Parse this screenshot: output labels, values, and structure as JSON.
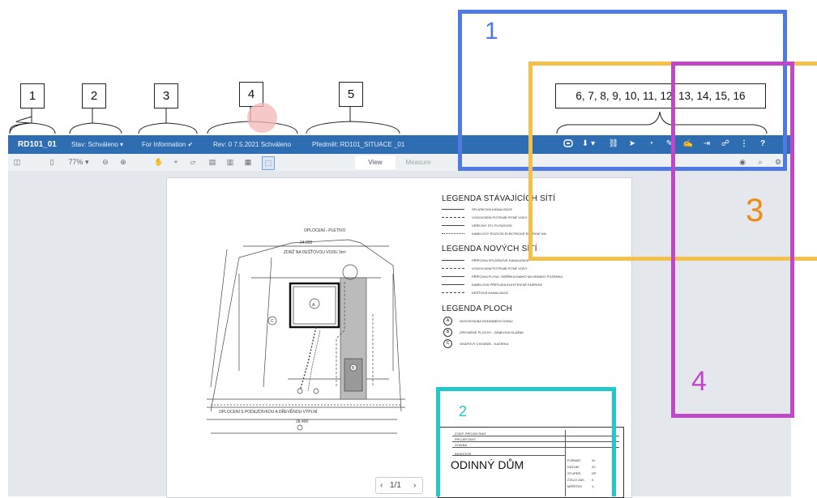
{
  "callouts": {
    "c1": "1",
    "c2": "2",
    "c3": "3",
    "c4": "4",
    "c5": "5",
    "toolbar_icons": "6, 7, 8, 9, 10, 11, 12, 13, 14, 15, 16"
  },
  "region_labels": {
    "blue": "1",
    "orange": "3",
    "purple": "4",
    "teal": "2"
  },
  "colors": {
    "blue_box": "#4f79e3",
    "orange_box": "#f5c04a",
    "purple_box": "#c147c9",
    "teal_box": "#22c7c9",
    "app_bar": "#2f6db2"
  },
  "topbar": {
    "doc_name": "RD101_01",
    "status": "Stav: Schváleno",
    "info": "For Information",
    "revision": "Rev: 0  7.5.2021  Schváleno",
    "subject": "Předmět: RD101_SITUACE _01",
    "icons": [
      "comment-icon",
      "download-icon",
      "link-icon",
      "send-icon",
      "chat-icon",
      "edit-icon",
      "markup-icon",
      "export-icon",
      "share-icon",
      "more-icon",
      "help-icon"
    ]
  },
  "toolbar": {
    "zoom": "77%",
    "tab_view": "View",
    "tab_measure": "Measure"
  },
  "legend": {
    "existing_title": "LEGENDA STÁVAJÍCÍCH SÍTÍ",
    "existing_items": [
      "SPLAŠKOVÁ KANALIZACE",
      "VODOVODNÍ POTRUBÍ PITNÉ VODY",
      "VEŘEJNÝ STL PLYNOVOD",
      "KABELOVÝ ROZVOD ELEKTRICKÉ ENERGIE NN"
    ],
    "new_title": "LEGENDA NOVÝCH SÍTÍ",
    "new_items": [
      "PŘÍPOJKA SPLAŠKOVÉ KANALIZACE",
      "VODOVODNÍ POTRUBÍ PITNÉ VODY",
      "PŘÍPOJKA PLYNU, SKŘÍŇKA MIAHO NA HRANICI POZEMKU",
      "KABELOVÁ PŘÍPOJKA ELEKTRICKÉ ENERGIE",
      "DEŠŤOVÁ KANALIZACE"
    ],
    "area_title": "LEGENDA PLOCH",
    "area_items": [
      {
        "symbol": "A",
        "label": "NOVOSTAVBA RODINNÉHO DOMU"
      },
      {
        "symbol": "B",
        "label": "ZPEVNĚNÉ PLOCHY - ZÁMKOVÁ DLAŽBA"
      },
      {
        "symbol": "C",
        "label": "OKAPOVÝ CHODNÍK - KAČÍRKA"
      }
    ]
  },
  "drawing": {
    "fence_label": "OPLOCENÍ - PLETIVO",
    "rain_label": "ZDRŽ NA DEŠŤOVOU VODU 3m³",
    "fence_bottom": "OPLOCENÍ S PODEZDÍVKOU A DŘEVĚNOU VÝPLNÍ",
    "dim_top": "24.900",
    "dim_bottom": "28.400",
    "house_label": "A",
    "c_label": "C",
    "b_label": "B"
  },
  "title_block": {
    "rows": [
      "ZODP. PROJEKTANT",
      "PROJEKTANT",
      "STAVBA",
      "INVESTOR"
    ],
    "title": "ODINNÝ DŮM",
    "right_rows": [
      "FORMÁT",
      "DATUM",
      "STUPEŇ",
      "ČÍSLO ZAK.",
      "MĚŘÍTKO"
    ],
    "right_vals": [
      "2x",
      "22.",
      "DP",
      "0",
      "1:"
    ]
  },
  "pager": {
    "prev": "‹",
    "page": "1/1",
    "next": "›"
  }
}
